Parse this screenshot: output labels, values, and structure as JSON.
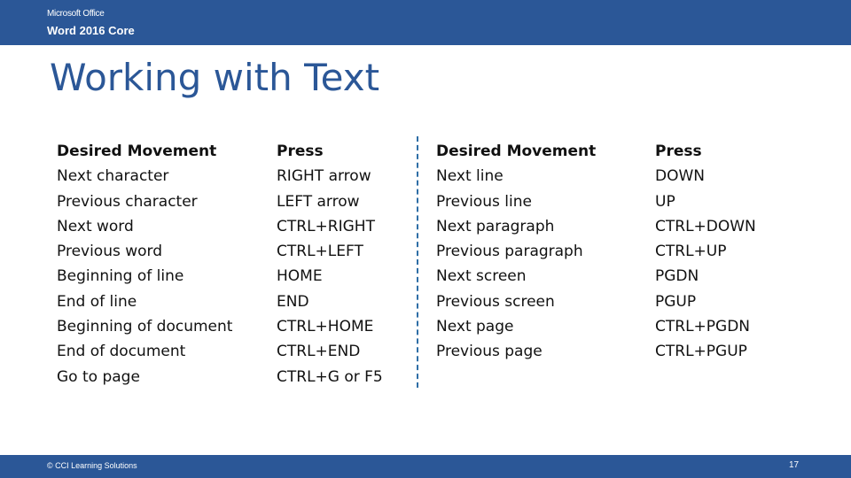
{
  "header": {
    "suite": "Microsoft Office",
    "product": "Word 2016 Core"
  },
  "slide": {
    "title": "Working with Text"
  },
  "tables": [
    {
      "headers": [
        "Desired Movement",
        "Press"
      ],
      "rows": [
        [
          "Next character",
          "RIGHT arrow"
        ],
        [
          "Previous character",
          "LEFT arrow"
        ],
        [
          "Next word",
          "CTRL+RIGHT"
        ],
        [
          "Previous word",
          "CTRL+LEFT"
        ],
        [
          "Beginning of line",
          "HOME"
        ],
        [
          "End of line",
          "END"
        ],
        [
          "Beginning of document",
          "CTRL+HOME"
        ],
        [
          "End of document",
          "CTRL+END"
        ],
        [
          "Go to page",
          "CTRL+G or F5"
        ]
      ]
    },
    {
      "headers": [
        "Desired Movement",
        "Press"
      ],
      "rows": [
        [
          "Next line",
          "DOWN"
        ],
        [
          "Previous line",
          "UP"
        ],
        [
          "Next paragraph",
          "CTRL+DOWN"
        ],
        [
          "Previous paragraph",
          "CTRL+UP"
        ],
        [
          "Next screen",
          "PGDN"
        ],
        [
          "Previous screen",
          "PGUP"
        ],
        [
          "Next page",
          "CTRL+PGDN"
        ],
        [
          "Previous page",
          "CTRL+PGUP"
        ]
      ]
    }
  ],
  "footer": {
    "copyright": "© CCI Learning Solutions",
    "page_number": "17"
  },
  "colors": {
    "brand": "#2b5797",
    "divider": "#2e6ea6"
  }
}
